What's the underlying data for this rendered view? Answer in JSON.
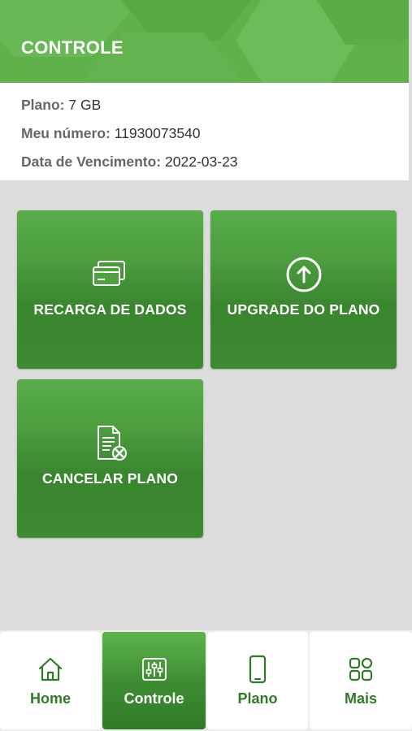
{
  "header": {
    "title": "CONTROLE"
  },
  "info": {
    "plan_label": "Plano:",
    "plan_value": "7 GB",
    "number_label": "Meu número:",
    "number_value": "11930073540",
    "due_label": "Data de Vencimento:",
    "due_value": "2022-03-23"
  },
  "tiles": [
    {
      "label": "RECARGA DE DADOS",
      "icon": "credit-cards-icon"
    },
    {
      "label": "UPGRADE DO PLANO",
      "icon": "arrow-up-circle-icon"
    },
    {
      "label": "CANCELAR PLANO",
      "icon": "document-cancel-icon"
    }
  ],
  "nav": [
    {
      "label": "Home",
      "icon": "home-icon",
      "active": false
    },
    {
      "label": "Controle",
      "icon": "sliders-icon",
      "active": true
    },
    {
      "label": "Plano",
      "icon": "smartphone-icon",
      "active": false
    },
    {
      "label": "Mais",
      "icon": "grid-icon",
      "active": false
    }
  ],
  "colors": {
    "brand_green": "#5fb14a",
    "dark_green": "#2f7a27",
    "background": "#dcdcdc"
  }
}
